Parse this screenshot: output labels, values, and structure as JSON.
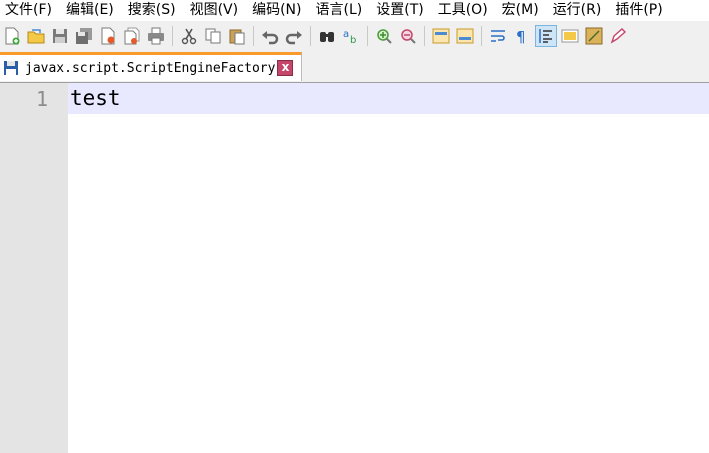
{
  "menu": {
    "items": [
      "文件(F)",
      "编辑(E)",
      "搜索(S)",
      "视图(V)",
      "编码(N)",
      "语言(L)",
      "设置(T)",
      "工具(O)",
      "宏(M)",
      "运行(R)",
      "插件(P)"
    ]
  },
  "toolbar": {
    "icons": [
      "new-file-icon",
      "open-file-icon",
      "save-icon",
      "save-all-icon",
      "close-icon",
      "close-all-icon",
      "print-icon",
      "cut-icon",
      "copy-icon",
      "paste-icon",
      "undo-icon",
      "redo-icon",
      "find-icon",
      "replace-icon",
      "zoom-in-icon",
      "zoom-out-icon",
      "sync-vertical-icon",
      "sync-horizontal-icon",
      "word-wrap-icon",
      "show-all-chars-icon",
      "indent-guide-icon",
      "doc-map-icon",
      "function-list-icon",
      "pencil-icon"
    ],
    "active_icon": "indent-guide-icon"
  },
  "tab": {
    "name": "javax.script.ScriptEngineFactory",
    "close_label": "x"
  },
  "editor": {
    "line_numbers": [
      "1"
    ],
    "lines": [
      "test"
    ]
  },
  "colors": {
    "tab_accent": "#f99a2a",
    "current_line": "#e8e8ff",
    "gutter": "#e4e4e4",
    "close_button": "#c4466b"
  }
}
